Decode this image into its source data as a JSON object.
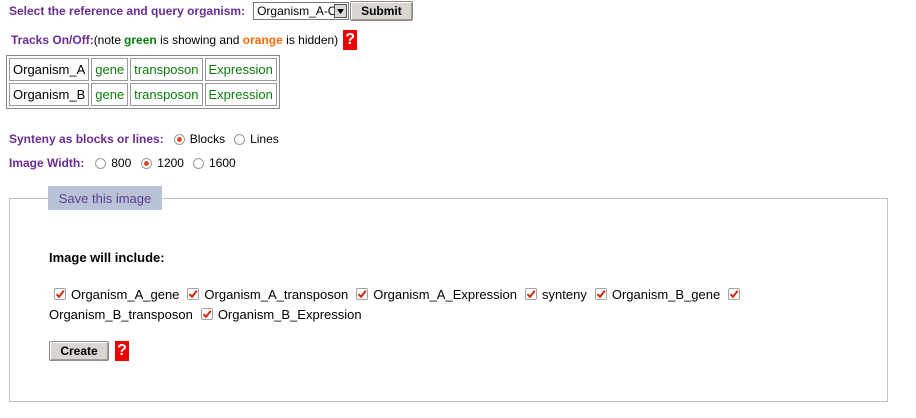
{
  "header": {
    "select_label": "Select the reference and query organism:",
    "select_value": "Organism_A-O",
    "submit_label": "Submit"
  },
  "tracks": {
    "label": "Tracks On/Off:",
    "note_prefix": "(note ",
    "note_green": "green",
    "note_mid": " is showing and ",
    "note_orange": "orange",
    "note_suffix": " is hidden)",
    "help": "?",
    "rows": [
      {
        "organism": "Organism_A",
        "gene": "gene",
        "transposon": "transposon",
        "expression": "Expression"
      },
      {
        "organism": "Organism_B",
        "gene": "gene",
        "transposon": "transposon",
        "expression": "Expression"
      }
    ]
  },
  "synteny": {
    "label": "Synteny as blocks or lines:",
    "options": [
      "Blocks",
      "Lines"
    ],
    "selected": "Blocks"
  },
  "image_width": {
    "label": "Image Width:",
    "options": [
      "800",
      "1200",
      "1600"
    ],
    "selected": "1200"
  },
  "save": {
    "legend": "Save this image",
    "include_label": "Image will include:",
    "items": [
      "Organism_A_gene",
      "Organism_A_transposon",
      "Organism_A_Expression",
      "synteny",
      "Organism_B_gene",
      "Organism_B_transposon",
      "Organism_B_Expression"
    ],
    "create_label": "Create",
    "help": "?"
  },
  "colors": {
    "label_purple": "#6a2d91",
    "shown_green": "#0a7d0a",
    "hidden_orange": "#ff6a00",
    "help_red": "#ee0000",
    "check_red": "#cc2b12"
  }
}
